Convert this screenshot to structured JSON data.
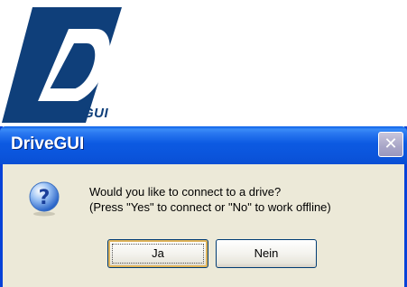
{
  "logo": {
    "letter": "D",
    "subtitle": "GUI",
    "brand_color": "#0f3f7a"
  },
  "dialog": {
    "title": "DriveGUI",
    "close_glyph": "✕",
    "icon": "question-icon",
    "message_line1": "Would you like to connect to a drive?",
    "message_line2": "(Press \"Yes\" to connect or \"No\" to work offline)",
    "yes_label": "Ja",
    "no_label": "Nein",
    "titlebar_color": "#0b55dc",
    "body_color": "#ece9d8"
  }
}
